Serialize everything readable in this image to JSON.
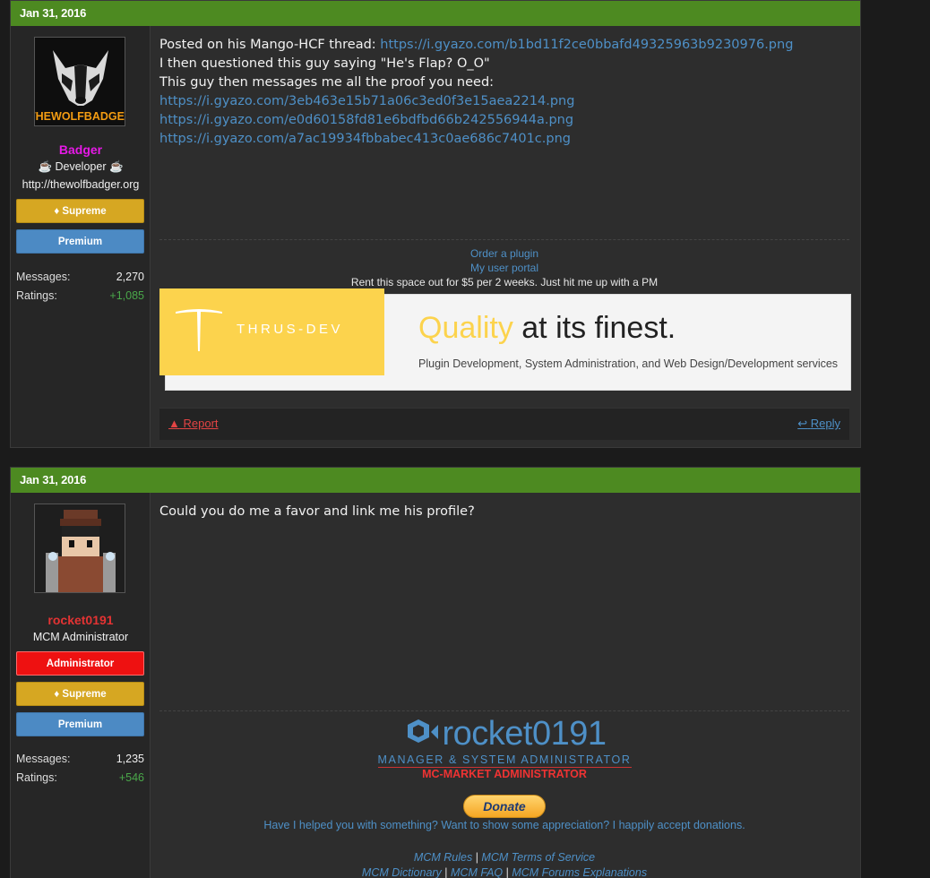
{
  "posts": [
    {
      "date": "Jan 31, 2016",
      "user": {
        "name": "Badger",
        "title": "Developer",
        "website": "http://thewolfbadger.org",
        "avatar_text": "THEWOLFBADGER",
        "banners": [
          "Supreme",
          "Premium"
        ],
        "messages_label": "Messages:",
        "messages": "2,270",
        "ratings_label": "Ratings:",
        "ratings": "+1,085"
      },
      "message": {
        "line1_text": "Posted on his Mango-HCF thread: ",
        "line1_link": "https://i.gyazo.com/b1bd11f2ce0bbafd49325963b9230976.png",
        "line2": "I then questioned this guy saying \"He's Flap? O_O\"",
        "line3": "This guy then messages me all the proof you need:",
        "links": [
          "https://i.gyazo.com/3eb463e15b71a06c3ed0f3e15aea2214.png",
          "https://i.gyazo.com/e0d60158fd81e6bdfbd66b242556944a.png",
          "https://i.gyazo.com/a7ac19934fbbabec413c0ae686c7401c.png"
        ]
      },
      "signature": {
        "link1": "Order a plugin",
        "link2": "My user portal",
        "rent": "Rent this space out for $5 per 2 weeks. Just hit me up with a PM",
        "ad_brand": "THRUS-DEV",
        "ad_quality": "Quality",
        "ad_rest": " at its finest.",
        "ad_sub": "Plugin Development, System Administration, and Web Design/Development services"
      },
      "actions": {
        "report": "Report",
        "reply": "Reply"
      }
    },
    {
      "date": "Jan 31, 2016",
      "user": {
        "name": "rocket0191",
        "title": "MCM Administrator",
        "banners": [
          "Administrator",
          "Supreme",
          "Premium"
        ],
        "messages_label": "Messages:",
        "messages": "1,235",
        "ratings_label": "Ratings:",
        "ratings": "+546"
      },
      "message": {
        "text": "Could you do me a favor and link me his profile?"
      },
      "signature": {
        "logo_name": "rocket0191",
        "logo_role": "MANAGER & SYSTEM ADMINISTRATOR",
        "logo_mcm": "MC-MARKET ADMINISTRATOR",
        "donate": "Donate",
        "donate_text": "Have I helped you with something? Want to show some appreciation? I happily accept donations.",
        "links_row1": [
          "MCM Rules",
          "MCM Terms of Service"
        ],
        "links_row2": [
          "MCM Dictionary",
          "MCM FAQ",
          "MCM Forums Explanations"
        ]
      }
    }
  ],
  "colors": {
    "header_green": "#4d8a21",
    "link_blue": "#4e90c7",
    "badger_name": "#e619e6",
    "rocket_name": "#e33333",
    "supreme": "#d6a722",
    "premium": "#4c8ac4",
    "admin": "#ee1111"
  }
}
